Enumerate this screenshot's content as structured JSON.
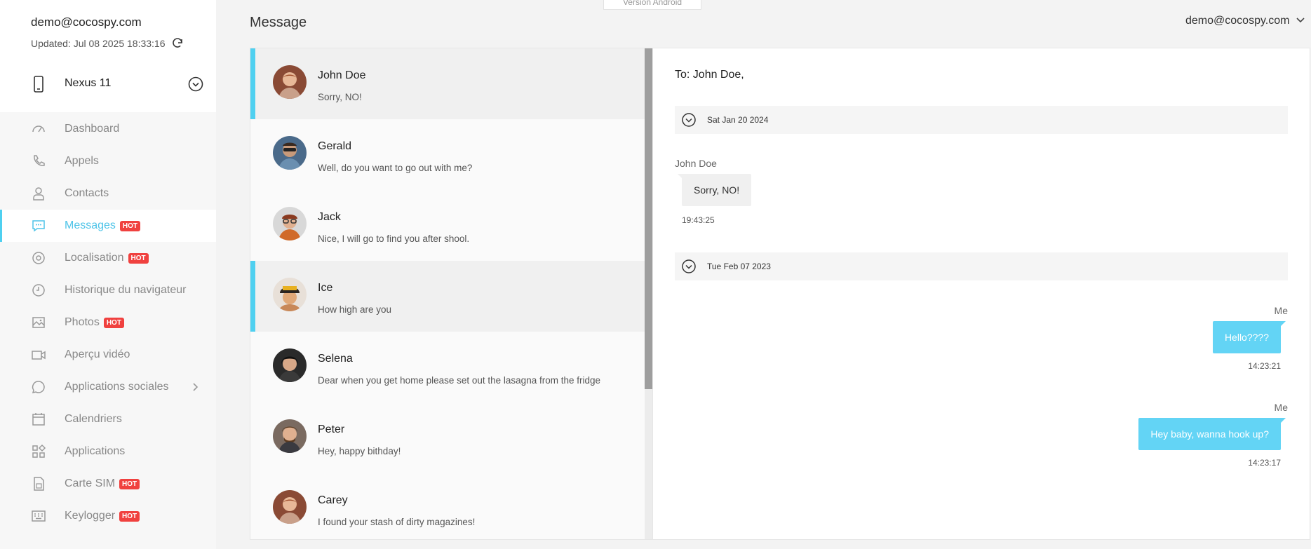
{
  "account": {
    "email": "demo@cocospy.com",
    "updated": "Updated: Jul 08 2025 18:33:16"
  },
  "device": {
    "name": "Nexus 11"
  },
  "nav": {
    "items": [
      {
        "label": "Dashboard",
        "icon": "gauge-icon",
        "hot": ""
      },
      {
        "label": "Appels",
        "icon": "phone-icon",
        "hot": ""
      },
      {
        "label": "Contacts",
        "icon": "user-icon",
        "hot": ""
      },
      {
        "label": "Messages",
        "icon": "chat-icon",
        "hot": "HOT",
        "active": true
      },
      {
        "label": "Localisation",
        "icon": "location-icon",
        "hot": "HOT"
      },
      {
        "label": "Historique du navigateur",
        "icon": "clock-icon",
        "hot": ""
      },
      {
        "label": "Photos",
        "icon": "image-icon",
        "hot": "HOT"
      },
      {
        "label": "Aperçu vidéo",
        "icon": "video-icon",
        "hot": ""
      },
      {
        "label": "Applications sociales",
        "icon": "speech-bubble-icon",
        "hot": "",
        "arrow": true
      },
      {
        "label": "Calendriers",
        "icon": "calendar-icon",
        "hot": ""
      },
      {
        "label": "Applications",
        "icon": "apps-icon",
        "hot": ""
      },
      {
        "label": "Carte SIM",
        "icon": "sim-icon",
        "hot": "HOT"
      },
      {
        "label": "Keylogger",
        "icon": "keyboard-icon",
        "hot": "HOT"
      }
    ]
  },
  "header": {
    "title": "Message",
    "version_tab": "Version Android",
    "account": "demo@cocospy.com"
  },
  "conversations": [
    {
      "name": "John Doe",
      "preview": "Sorry, NO!",
      "highlighted": true
    },
    {
      "name": "Gerald",
      "preview": "Well, do you want to go out with me?"
    },
    {
      "name": "Jack",
      "preview": "Nice, I will go to find you after shool."
    },
    {
      "name": "Ice",
      "preview": "How high are you",
      "highlighted": true
    },
    {
      "name": "Selena",
      "preview": "Dear when you get home please set out the lasagna from the fridge"
    },
    {
      "name": "Peter",
      "preview": "Hey, happy bithday!"
    },
    {
      "name": "Carey",
      "preview": "I found your stash of dirty magazines!"
    }
  ],
  "chat": {
    "to": "To: John Doe,",
    "groups": [
      {
        "date": "Sat Jan 20 2024",
        "messages": [
          {
            "sender": "John Doe",
            "text": "Sorry, NO!",
            "time": "19:43:25",
            "direction": "in"
          }
        ]
      },
      {
        "date": "Tue Feb 07 2023",
        "messages": [
          {
            "sender": "Me",
            "text": "Hello????",
            "time": "14:23:21",
            "direction": "out"
          },
          {
            "sender": "Me",
            "text": "Hey baby, wanna hook up?",
            "time": "14:23:17",
            "direction": "out"
          }
        ]
      }
    ]
  },
  "colors": {
    "accent": "#4fd0f0",
    "bubble_out": "#63d4f5",
    "hot_badge": "#f0413f"
  }
}
